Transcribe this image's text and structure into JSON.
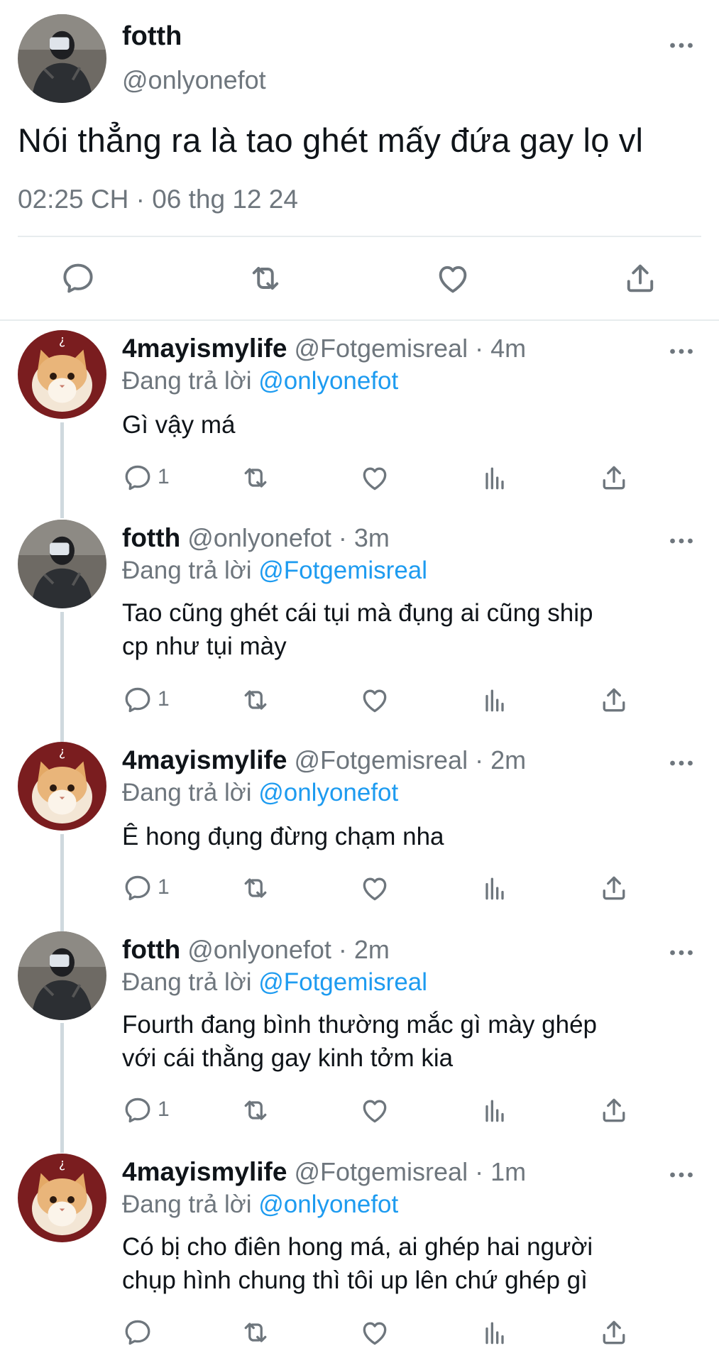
{
  "main_tweet": {
    "display_name": "fotth",
    "handle": "@onlyonefot",
    "text": "Nói thẳng ra là tao ghét mấy đứa gay lọ vl",
    "timestamp": "02:25 CH · 06 thg 12 24",
    "more_icon": "more-horizontal-icon",
    "actions": [
      "reply-icon",
      "retweet-icon",
      "like-icon",
      "share-icon"
    ]
  },
  "replies": [
    {
      "display_name": "4mayismylife",
      "handle": "@Fotgemisreal",
      "time": "· 4m",
      "replying_label": "Đang trả lời",
      "replying_to": "@onlyonefot",
      "lines": [
        "Gì vậy má"
      ],
      "reply_count": "1"
    },
    {
      "display_name": "fotth",
      "handle": "@onlyonefot",
      "time": "· 3m",
      "replying_label": "Đang trả lời",
      "replying_to": "@Fotgemisreal",
      "lines": [
        "Tao cũng ghét cái tụi mà đụng ai cũng ship",
        "cp như tụi mày"
      ],
      "reply_count": "1"
    },
    {
      "display_name": "4mayismylife",
      "handle": "@Fotgemisreal",
      "time": "· 2m",
      "replying_label": "Đang trả lời",
      "replying_to": "@onlyonefot",
      "lines": [
        "Ê hong đụng đừng chạm nha"
      ],
      "reply_count": "1"
    },
    {
      "display_name": "fotth",
      "handle": "@onlyonefot",
      "time": "· 2m",
      "replying_label": "Đang trả lời",
      "replying_to": "@Fotgemisreal",
      "lines": [
        "Fourth đang bình thường mắc gì mày ghép",
        "với cái thằng gay kinh tởm kia"
      ],
      "reply_count": "1"
    },
    {
      "display_name": "4mayismylife",
      "handle": "@Fotgemisreal",
      "time": "· 1m",
      "replying_label": "Đang trả lời",
      "replying_to": "@onlyonefot",
      "lines": [
        "Có bị cho điên hong má, ai ghép hai người",
        "chụp hình chung thì tôi up lên chứ ghép gì"
      ],
      "reply_count": ""
    }
  ],
  "colors": {
    "link": "#1d9bf0",
    "muted": "#6e767d",
    "text": "#0f1419"
  }
}
